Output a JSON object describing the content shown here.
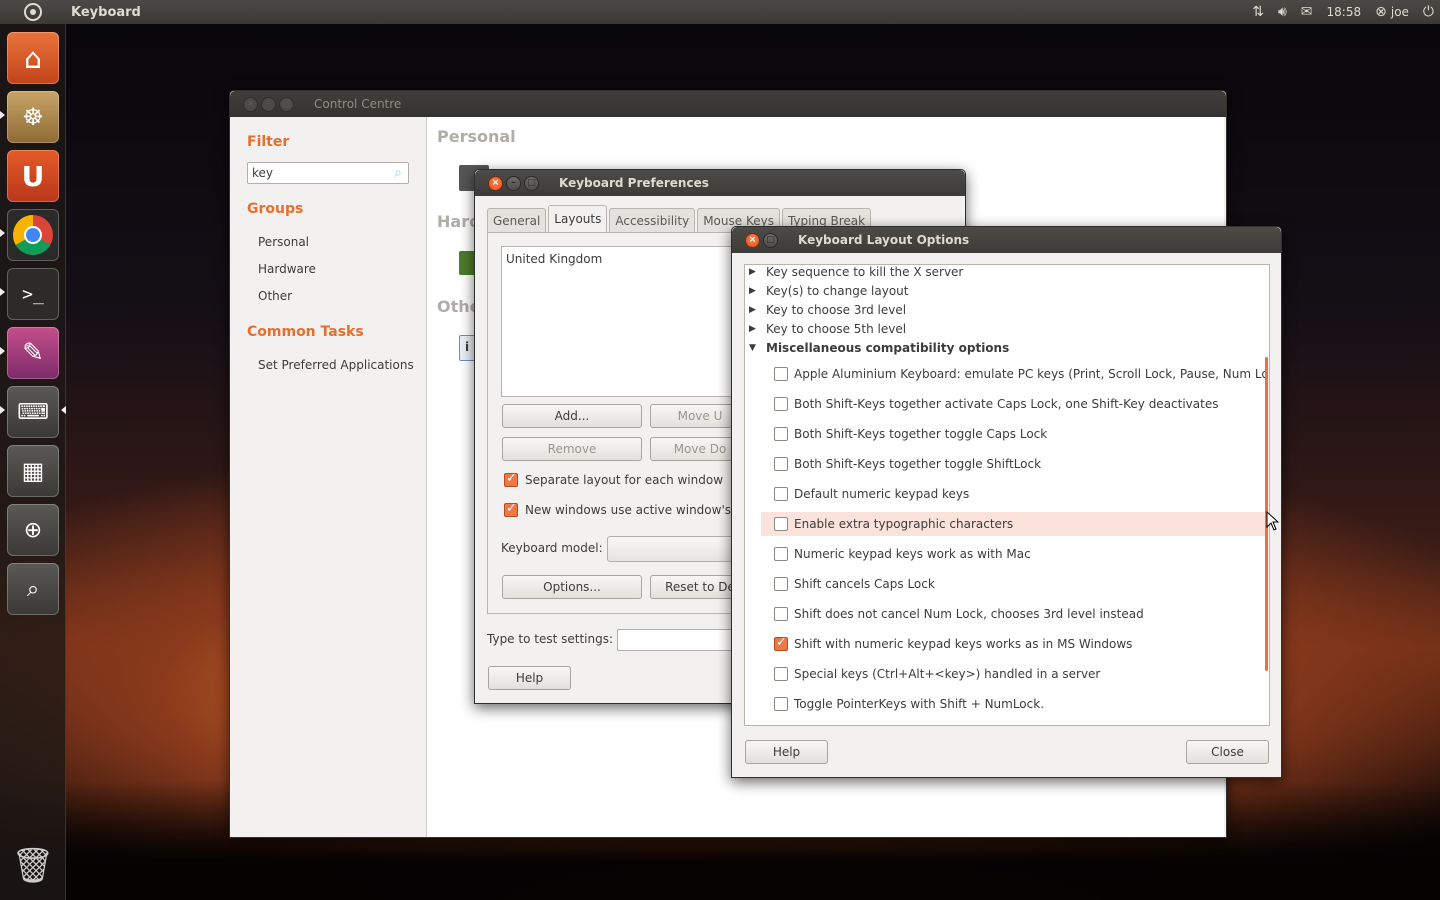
{
  "top_panel": {
    "app_title": "Keyboard",
    "clock": "18:58",
    "user": "joe"
  },
  "launcher": {
    "items": [
      {
        "name": "home-folder"
      },
      {
        "name": "software-center"
      },
      {
        "name": "ubuntu-one"
      },
      {
        "name": "chrome"
      },
      {
        "name": "terminal"
      },
      {
        "name": "system-settings"
      },
      {
        "name": "keyboard"
      },
      {
        "name": "workspace-switcher"
      },
      {
        "name": "magnifier"
      },
      {
        "name": "search"
      }
    ],
    "trash": "trash"
  },
  "control_centre": {
    "title": "Control Centre",
    "filter_heading": "Filter",
    "search_value": "key",
    "groups_heading": "Groups",
    "groups": [
      "Personal",
      "Hardware",
      "Other"
    ],
    "common_tasks_heading": "Common Tasks",
    "tasks": [
      "Set Preferred Applications"
    ],
    "sections": [
      "Personal",
      "Hard",
      "Othe"
    ]
  },
  "keyboard_prefs": {
    "title": "Keyboard Preferences",
    "tabs": [
      "General",
      "Layouts",
      "Accessibility",
      "Mouse Keys",
      "Typing Break"
    ],
    "active_tab": "Layouts",
    "layouts": [
      "United Kingdom"
    ],
    "buttons": {
      "add": "Add...",
      "move_up": "Move U",
      "remove": "Remove",
      "move_down": "Move Do",
      "options": "Options...",
      "reset": "Reset to De",
      "help": "Help"
    },
    "checks": [
      {
        "label": "Separate layout for each window",
        "checked": true
      },
      {
        "label": "New windows use active window's layo",
        "checked": true
      }
    ],
    "keyboard_model_label": "Keyboard model:",
    "test_label": "Type to test settings:"
  },
  "layout_options": {
    "title": "Keyboard Layout Options",
    "collapsed": [
      "Key sequence to kill the X server",
      "Key(s) to change layout",
      "Key to choose 3rd level",
      "Key to choose 5th level"
    ],
    "expanded_heading": "Miscellaneous compatibility options",
    "options": [
      {
        "label": "Apple Aluminium Keyboard: emulate PC keys (Print, Scroll Lock, Pause, Num Lock)",
        "checked": false
      },
      {
        "label": "Both Shift-Keys together activate Caps Lock, one Shift-Key deactivates",
        "checked": false
      },
      {
        "label": "Both Shift-Keys together toggle Caps Lock",
        "checked": false
      },
      {
        "label": "Both Shift-Keys together toggle ShiftLock",
        "checked": false
      },
      {
        "label": "Default numeric keypad keys",
        "checked": false
      },
      {
        "label": "Enable extra typographic characters",
        "checked": false
      },
      {
        "label": "Numeric keypad keys work as with Mac",
        "checked": false
      },
      {
        "label": "Shift cancels Caps Lock",
        "checked": false
      },
      {
        "label": "Shift does not cancel Num Lock, chooses 3rd level instead",
        "checked": false
      },
      {
        "label": "Shift with numeric keypad keys works as in MS Windows",
        "checked": true
      },
      {
        "label": "Special keys (Ctrl+Alt+<key>) handled in a server",
        "checked": false
      },
      {
        "label": "Toggle PointerKeys with Shift + NumLock.",
        "checked": false
      }
    ],
    "help_label": "Help",
    "close_label": "Close"
  }
}
